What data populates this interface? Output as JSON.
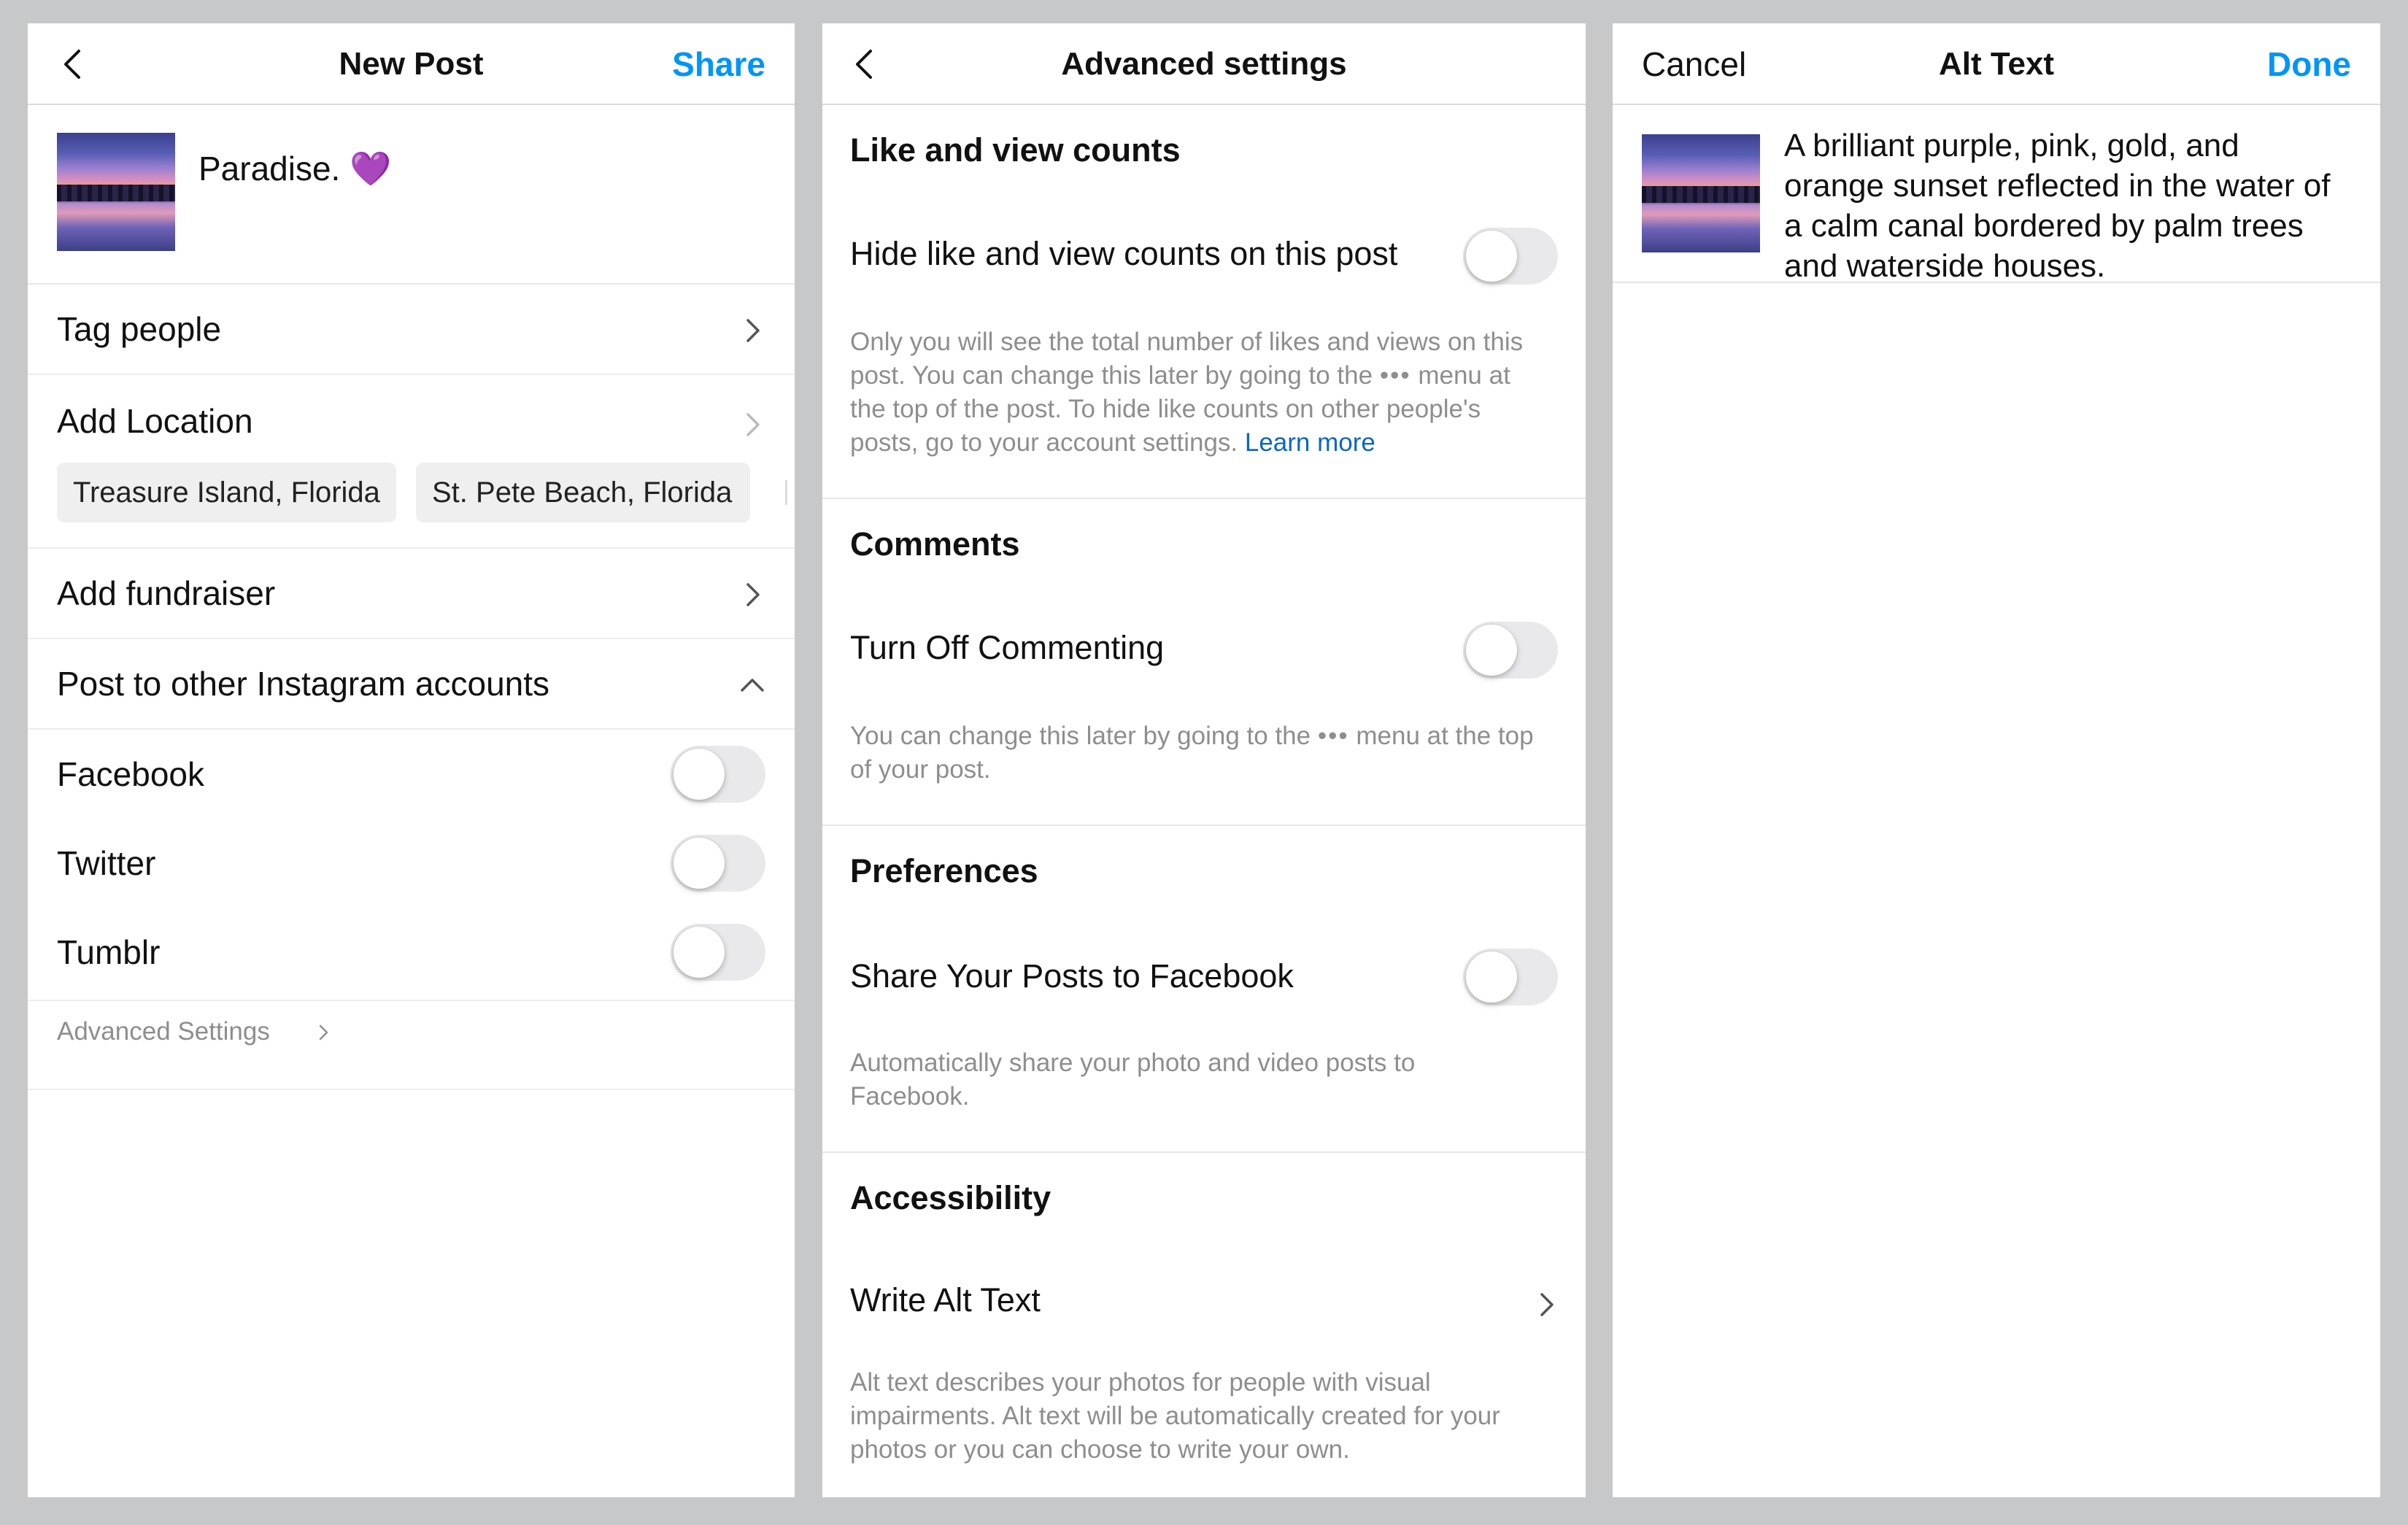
{
  "new_post": {
    "title": "New Post",
    "share_label": "Share",
    "caption": "Paradise.",
    "caption_emoji": "💜",
    "tag_people": "Tag people",
    "add_location": "Add Location",
    "location_suggestions": [
      "Treasure Island, Florida",
      "St. Pete Beach, Florida"
    ],
    "add_fundraiser": "Add fundraiser",
    "post_to_other": "Post to other Instagram accounts",
    "share_targets": [
      {
        "label": "Facebook",
        "on": false
      },
      {
        "label": "Twitter",
        "on": false
      },
      {
        "label": "Tumblr",
        "on": false
      }
    ],
    "advanced_settings_link": "Advanced Settings"
  },
  "advanced": {
    "title": "Advanced settings",
    "like_counts": {
      "heading": "Like and view counts",
      "toggle_label": "Hide like and view counts on this post",
      "toggle_on": false,
      "note": "Only you will see the total number of likes and views on this post. You can change this later by going to the",
      "note_dots": "•••",
      "note_rest": "menu at the top of the post. To hide like counts on other people's posts, go to your account settings.",
      "learn_more": "Learn more"
    },
    "comments": {
      "heading": "Comments",
      "toggle_label": "Turn Off Commenting",
      "toggle_on": false,
      "note": "You can change this later by going to the",
      "note_dots": "•••",
      "note_rest": "menu at the top of your post."
    },
    "preferences": {
      "heading": "Preferences",
      "toggle_label": "Share Your Posts to Facebook",
      "toggle_on": false,
      "note": "Automatically share your photo and video posts to Facebook."
    },
    "accessibility": {
      "heading": "Accessibility",
      "row_label": "Write Alt Text",
      "note": "Alt text describes your photos for people with visual impairments. Alt text will be automatically created for your photos or you can choose to write your own."
    }
  },
  "alt_text": {
    "cancel_label": "Cancel",
    "title": "Alt Text",
    "done_label": "Done",
    "text": "A brilliant purple, pink, gold, and orange sunset reflected in the water of a calm canal bordered by palm trees and waterside houses."
  },
  "colors": {
    "accent": "#0095f6",
    "link": "#0a66c2",
    "background": "#c7c8ca",
    "muted_text": "#8e8e8e",
    "toggle_off": "#e9e9eb"
  }
}
